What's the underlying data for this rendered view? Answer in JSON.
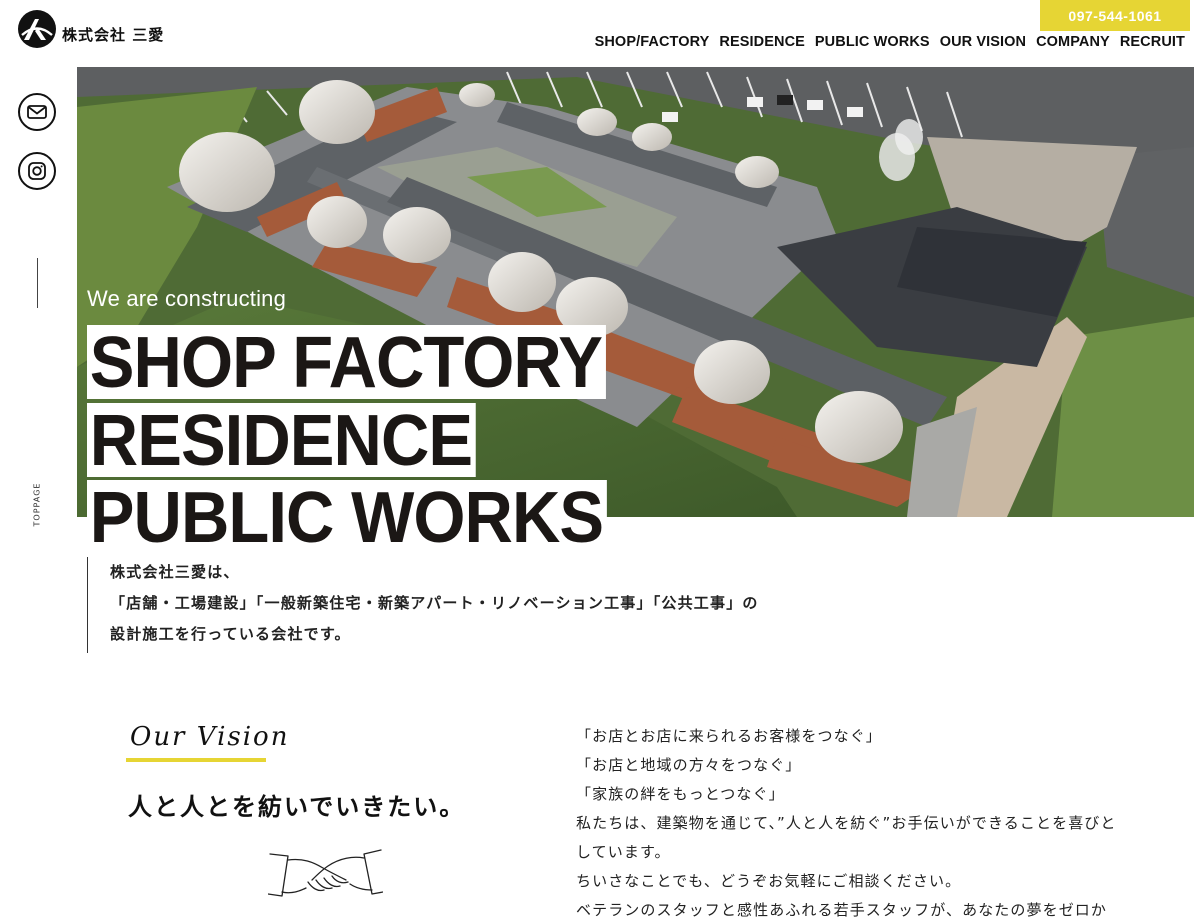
{
  "header": {
    "company_name": "株式会社 三愛",
    "phone": "097-544-1061",
    "nav": [
      "SHOP/FACTORY",
      "RESIDENCE",
      "PUBLIC WORKS",
      "OUR VISION",
      "COMPANY",
      "RECRUIT"
    ]
  },
  "rail": {
    "icons": [
      "mail-icon",
      "instagram-icon"
    ],
    "toppage_label": "TOPPAGE"
  },
  "hero": {
    "tagline": "We are constructing",
    "lines": [
      "SHOP FACTORY",
      "RESIDENCE",
      "PUBLIC WORKS"
    ]
  },
  "intro": {
    "lines": [
      "株式会社三愛は、",
      "「店舗・工場建設」「一般新築住宅・新築アパート・リノベーション工事」「公共工事」の",
      "設計施工を行っている会社です。"
    ]
  },
  "vision": {
    "title": "Our Vision",
    "headline": "人と人とを紡いでいきたい。",
    "copy": [
      "「お店とお店に来られるお客様をつなぐ」",
      "「お店と地域の方々をつなぐ」",
      "「家族の絆をもっとつなぐ」",
      "私たちは、建築物を通じて、”人と人を紡ぐ”お手伝いができることを喜びと",
      "しています。",
      "ちいさなことでも、どうぞお気軽にご相談ください。",
      "ベテランのスタッフと感性あふれる若手スタッフが、あなたの夢をゼロか"
    ]
  },
  "colors": {
    "accent": "#e6d534",
    "text": "#111111"
  }
}
